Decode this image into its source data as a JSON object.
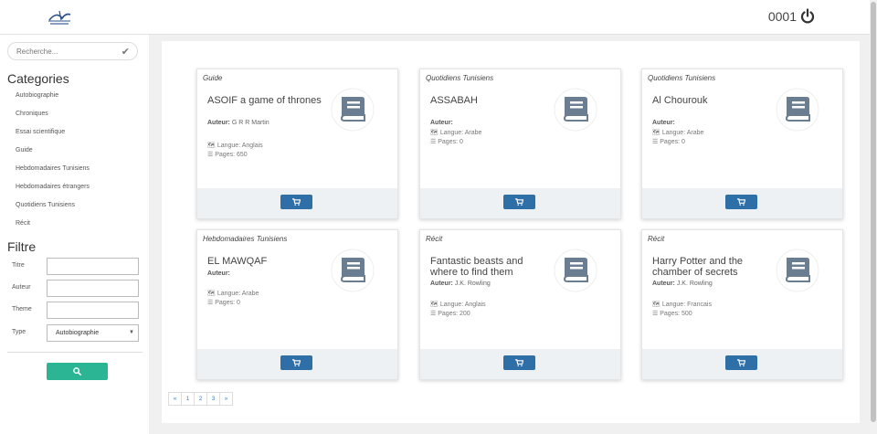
{
  "header": {
    "user_code": "0001"
  },
  "search": {
    "placeholder": "Recherche..."
  },
  "sidebar": {
    "categories_title": "Categories",
    "categories": [
      "Autobiographie",
      "Chroniques",
      "Essai scientifique",
      "Guide",
      "Hebdomadaires Tunisiens",
      "Hebdomadaires étrangers",
      "Quotidiens Tunisiens",
      "Récit"
    ],
    "filter_title": "Filtre",
    "filter": {
      "titre_label": "Titre",
      "auteur_label": "Auteur",
      "theme_label": "Theme",
      "type_label": "Type",
      "type_value": "Autobiographie"
    }
  },
  "book_labels": {
    "author": "Auteur:",
    "language": "Langue:",
    "pages": "Pages:"
  },
  "books": [
    {
      "category": "Guide",
      "title": "ASOIF a game of thrones",
      "author": "G R R Martin",
      "language": "Anglais",
      "pages": "650"
    },
    {
      "category": "Quotidiens Tunisiens",
      "title": "ASSABAH",
      "author": "",
      "language": "Arabe",
      "pages": "0"
    },
    {
      "category": "Quotidiens Tunisiens",
      "title": "Al Chourouk",
      "author": "",
      "language": "Arabe",
      "pages": "0"
    },
    {
      "category": "Hebdomadaires Tunisiens",
      "title": "EL MAWQAF",
      "author": "",
      "language": "Arabe",
      "pages": "0"
    },
    {
      "category": "Récit",
      "title": "Fantastic beasts and where to find them",
      "author": "J.K. Rowling",
      "language": "Anglais",
      "pages": "200"
    },
    {
      "category": "Récit",
      "title": "Harry Potter and the chamber of secrets",
      "author": "J.K. Rowling",
      "language": "Francais",
      "pages": "500"
    }
  ],
  "pagination": {
    "prev": "«",
    "pages": [
      "1",
      "2",
      "3"
    ],
    "next": "»"
  },
  "colors": {
    "accent_green": "#2bb594",
    "cart_blue": "#2f6fa8",
    "book_icon": "#6a7d91"
  },
  "icons": {
    "logo": "library-logo",
    "power": "power-icon",
    "check": "check-icon",
    "search": "search-icon",
    "cart": "cart-icon",
    "book": "book-icon",
    "language": "language-icon",
    "pages": "list-icon"
  }
}
